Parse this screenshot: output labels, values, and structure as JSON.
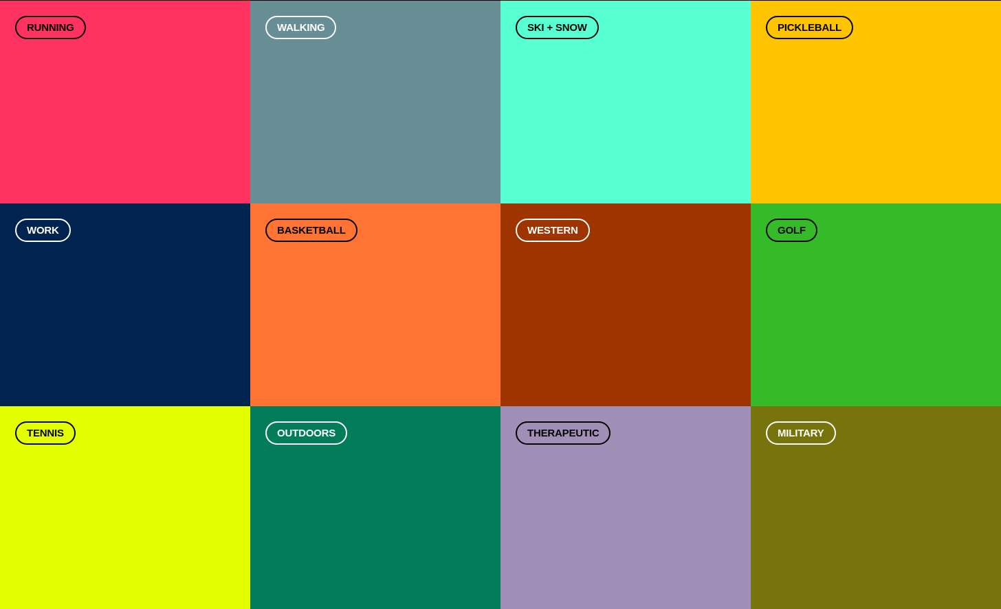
{
  "categories": [
    {
      "label": "RUNNING",
      "color": "#FF335F",
      "text_color": "dark"
    },
    {
      "label": "WALKING",
      "color": "#688E95",
      "text_color": "light"
    },
    {
      "label": "SKI + SNOW",
      "color": "#58FFD2",
      "text_color": "dark"
    },
    {
      "label": "PICKLEBALL",
      "color": "#FFC400",
      "text_color": "dark"
    },
    {
      "label": "WORK",
      "color": "#00234F",
      "text_color": "light"
    },
    {
      "label": "BASKETBALL",
      "color": "#FF7432",
      "text_color": "dark"
    },
    {
      "label": "WESTERN",
      "color": "#9E3500",
      "text_color": "light"
    },
    {
      "label": "GOLF",
      "color": "#35BA2A",
      "text_color": "dark"
    },
    {
      "label": "TENNIS",
      "color": "#E3FF00",
      "text_color": "dark"
    },
    {
      "label": "OUTDOORS",
      "color": "#037D59",
      "text_color": "light"
    },
    {
      "label": "THERAPEUTIC",
      "color": "#A28FB8",
      "text_color": "dark"
    },
    {
      "label": "MILITARY",
      "color": "#78740D",
      "text_color": "light"
    }
  ]
}
